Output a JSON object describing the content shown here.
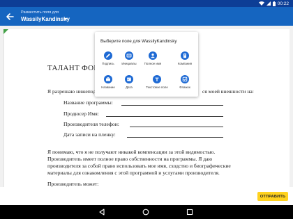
{
  "status_bar": {
    "time": "00:22"
  },
  "app_bar": {
    "subtitle": "Разместить поля для",
    "title": "WassilyKandinsky"
  },
  "document": {
    "heading": "ТАЛАНТ ФОРМ",
    "consent_start": "Я разрешаю нижепод",
    "consent_end": "ся моей внешности на:",
    "fields": [
      "Название программы:",
      "Продюсер Имя:",
      "Производителя телефон:",
      "Дата записи на пленку:"
    ],
    "paragraph_lines": [
      "Я понимаю, что я не получают никакой компенсации за этой видимостью.",
      "Производитель имеет полное право собственности на программы. Я даю",
      "производителя за собой право использовать мое имя, сходство и биографические",
      "материалы для ознакомления с этой программой и услугами производителя."
    ],
    "last_line": "Производитель может:"
  },
  "popup": {
    "title": "Выберите поле для WassilyKandinsky",
    "options": [
      {
        "label": "Подпись",
        "icon": "pen-icon"
      },
      {
        "label": "Инициалы",
        "icon": "initials-icon"
      },
      {
        "label": "Полное имя",
        "icon": "person-icon"
      },
      {
        "label": "Компания",
        "icon": "company-icon"
      },
      {
        "label": "Название",
        "icon": "briefcase-icon"
      },
      {
        "label": "Дата",
        "icon": "calendar-icon"
      },
      {
        "label": "Текстовое поле",
        "icon": "text-icon"
      },
      {
        "label": "Флажок",
        "icon": "checkbox-icon"
      }
    ]
  },
  "send_button": {
    "label": "ОТПРАВИТЬ"
  },
  "colors": {
    "status_bar": "#0d3e96",
    "app_bar": "#1565c0",
    "accent_icon": "#1e6ad4",
    "send_button": "#ffd21f",
    "corner_flag": "#43a047"
  }
}
